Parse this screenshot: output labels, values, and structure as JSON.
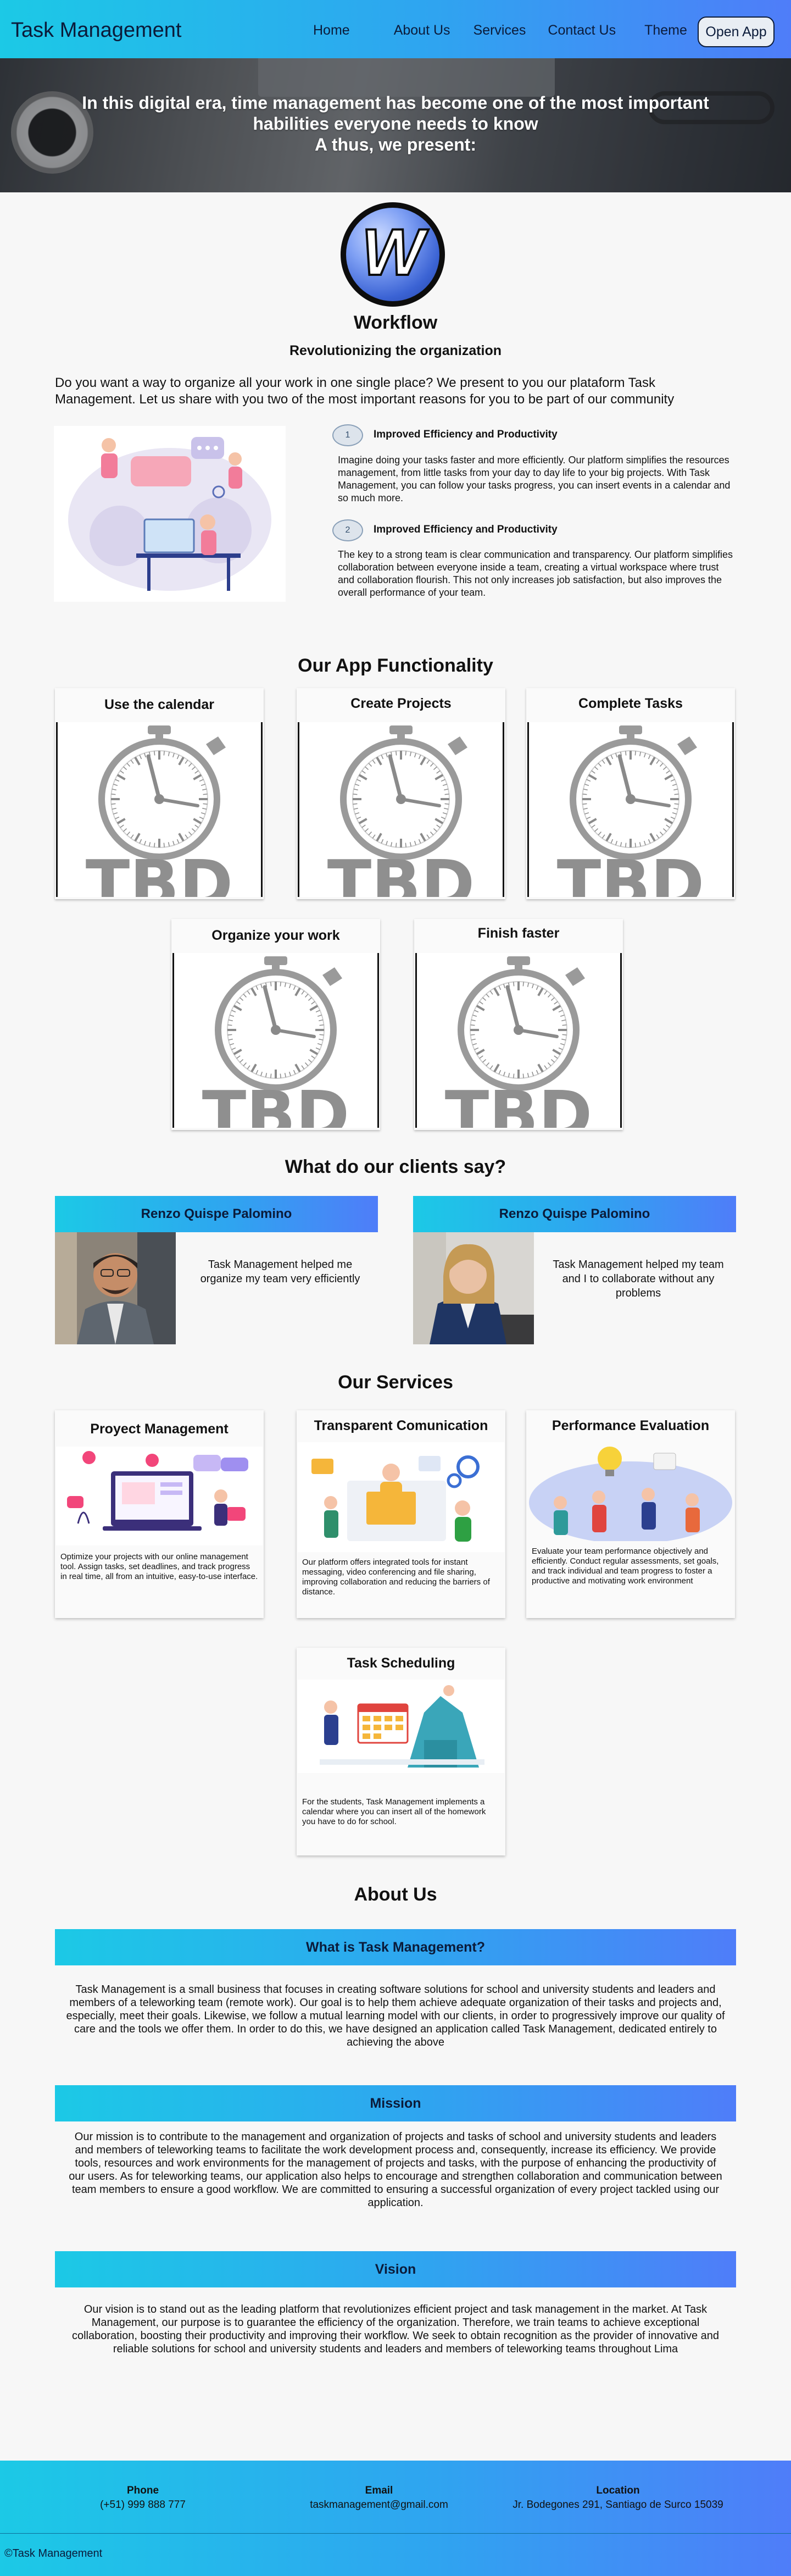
{
  "nav": {
    "brand": "Task Management",
    "links": [
      "Home",
      "About Us",
      "Services",
      "Contact Us",
      "Theme"
    ],
    "open_app": "Open App"
  },
  "hero": {
    "line1": "In this digital era, time management has become one of the most important",
    "line2": "habilities everyone needs to know",
    "line3": "A thus, we present:"
  },
  "workflow": {
    "logo_letter": "W",
    "title": "Workflow",
    "subtitle": "Revolutionizing the organization",
    "intro": "Do you want a way to organize all your work in one single place? We present to you our plataform Task Management. Let us share with you two of the most important reasons for you to be part of our community"
  },
  "benefits": [
    {
      "num": "1",
      "title": "Improved Efficiency and Productivity",
      "text": "Imagine doing your tasks faster and more efficiently. Our platform simplifies the resources management, from little tasks from your day to day life to your big projects. With Task Management, you can follow your tasks progress, you can insert events in a calendar and so much more."
    },
    {
      "num": "2",
      "title": "Improved Efficiency and Productivity",
      "text": "The key to a strong team is clear communication and transparency. Our platform simplifies collaboration between everyone inside a team, creating a virtual workspace where trust and collaboration flourish. This not only increases job satisfaction, but also improves the overall performance of your team."
    }
  ],
  "functionality": {
    "title": "Our App Functionality",
    "tbd": "TBD",
    "cards": [
      "Use the calendar",
      "Create Projects",
      "Complete Tasks",
      "Organize your work",
      "Finish faster"
    ]
  },
  "clients": {
    "title": "What do our clients say?",
    "items": [
      {
        "name": "Renzo Quispe Palomino",
        "quote": "Task Management helped me organize my team very efficiently"
      },
      {
        "name": "Renzo Quispe Palomino",
        "quote": "Task Management helped my team and I to collaborate without any problems"
      }
    ]
  },
  "services": {
    "title": "Our Services",
    "items": [
      {
        "title": "Proyect Management",
        "desc": "Optimize your projects with our online management tool. Assign tasks, set deadlines, and track progress in real time, all from an intuitive, easy-to-use interface."
      },
      {
        "title": "Transparent Comunication",
        "desc": "Our platform offers integrated tools for instant messaging, video conferencing and file sharing, improving collaboration and reducing the barriers of distance."
      },
      {
        "title": "Performance Evaluation",
        "desc": "Evaluate your team performance objectively and efficiently. Conduct regular assessments, set goals, and track individual and team progress to foster a productive and motivating work environment"
      },
      {
        "title": "Task Scheduling",
        "desc": "For the students, Task Management implements a calendar where you can insert all of the homework you have to do for school."
      }
    ]
  },
  "about": {
    "title": "About Us",
    "blocks": [
      {
        "heading": "What is Task Management?",
        "text": "Task Management is a small business that focuses in creating software solutions for school and university students and leaders and members of a teleworking team (remote work). Our goal is to help them achieve adequate organization of their tasks and projects and, especially, meet their goals. Likewise, we follow a mutual learning model with our clients, in order to progressively improve our quality of care and the tools we offer them. In order to do this, we have designed an application called Task Management, dedicated entirely to achieving the above"
      },
      {
        "heading": "Mission",
        "text": "Our mission is to contribute to the management and organization of projects and tasks of school and university students and leaders and members of teleworking teams to facilitate the work development process and, consequently, increase its efficiency. We provide tools, resources and work environments for the management of projects and tasks, with the purpose of enhancing the productivity of our users. As for teleworking teams, our application also helps to encourage and strengthen collaboration and communication between team members to ensure a good workflow. We are committed to ensuring a successful organization of every project tackled using our application."
      },
      {
        "heading": "Vision",
        "text": "Our vision is to stand out as the leading platform that revolutionizes efficient project and task management in the market. At Task Management, our purpose is to guarantee the efficiency of the organization. Therefore, we train teams to achieve exceptional collaboration, boosting their productivity and improving their workflow. We seek to obtain recognition as the provider of innovative and reliable solutions for school and university students and leaders and members of teleworking teams throughout Lima"
      }
    ]
  },
  "footer": {
    "phone_label": "Phone",
    "phone": "(+51) 999 888 777",
    "email_label": "Email",
    "email": "taskmanagement@gmail.com",
    "location_label": "Location",
    "location": "Jr. Bodegones 291, Santiago de Surco 15039",
    "copyright": "©Task Management"
  },
  "colors": {
    "gradient_start": "#1cc9e6",
    "gradient_end": "#4f7df9",
    "text_dark": "#0b1b3a"
  }
}
